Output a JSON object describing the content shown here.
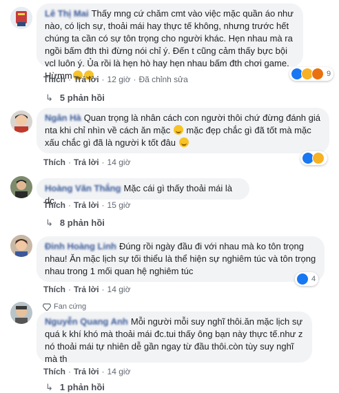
{
  "comments": [
    {
      "author": "Lê Thị Mai",
      "text": "Thấy mng cứ chăm cmt vào việc mặc quần áo như nào, có lịch sự, thoải mái hay thực tế không, nhưng trước hết chúng ta cần có sự tôn trọng cho người khác. Hẹn nhau mà ra ngồi bấm đth thì đừng nói chỉ ý. Đến t cũng cảm thấy bực bội vcl luôn ý. Ủa rồi là hẹn hò hay hẹn nhau bấm đth chơi game. Hừmm",
      "like": "Thích",
      "reply": "Trả lời",
      "time": "12 giờ",
      "edited": "Đã chỉnh sửa",
      "react_count": "9",
      "replies": "5 phản hồi"
    },
    {
      "author": "Ngân Hà",
      "text": "Quan trọng là nhân cách con người thôi chứ đừng đánh giá nta khi chỉ nhìn về cách ăn mặc",
      "text2": "mặc đẹp chắc gì đã tốt mà mặc xấu chắc gì đã là người k tốt đâu",
      "like": "Thích",
      "reply": "Trả lời",
      "time": "14 giờ",
      "react_count": ""
    },
    {
      "author": "Hoàng Văn Thắng",
      "text": "Mặc cái gì thấy thoải mái là dc.",
      "like": "Thích",
      "reply": "Trả lời",
      "time": "15 giờ",
      "replies": "8 phản hồi"
    },
    {
      "author": "Đinh Hoàng Linh",
      "text": "Đúng rồi ngày đầu đi với nhau mà ko tôn trọng nhau! Ăn mặc lịch sự tối thiểu là thể hiện sự nghiêm túc và tôn trọng nhau trong 1 mối quan hệ nghiêm túc",
      "like": "Thích",
      "reply": "Trả lời",
      "time": "14 giờ",
      "react_count": "4"
    },
    {
      "badge": "Fan cứng",
      "author": "Nguyễn Quang Anh",
      "text": "Mỗi người mỗi suy nghĩ thôi.ăn mặc lịch sự quá k khí khó mà thoải mái đc.tui thấy ông bạn này thực tế.như z nó thoải mái tự nhiên dễ gần ngay từ đầu thôi.còn tùy suy nghĩ mà th",
      "like": "Thích",
      "reply": "Trả lời",
      "time": "14 giờ",
      "replies": "1 phản hồi"
    }
  ],
  "colors": {
    "bubble": "#f2f3f5",
    "link": "#385898",
    "like": "#1877f2"
  }
}
